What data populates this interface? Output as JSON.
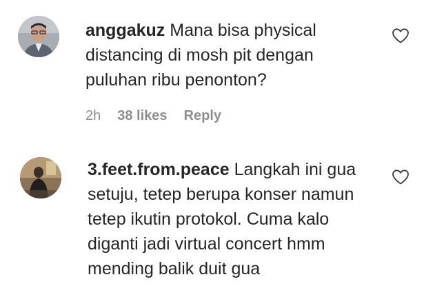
{
  "comments": [
    {
      "username": "anggakuz",
      "text": "Mana bisa physical distancing di mosh pit dengan puluhan ribu penonton?",
      "time": "2h",
      "likes": "38 likes",
      "reply_label": "Reply",
      "like_icon": "heart-outline-icon"
    },
    {
      "username": "3.feet.from.peace",
      "text": "Langkah ini gua setuju, tetep berupa konser namun tetep ikutin protokol. Cuma kalo diganti jadi virtual concert hmm mending balik duit gua",
      "like_icon": "heart-outline-icon"
    }
  ]
}
